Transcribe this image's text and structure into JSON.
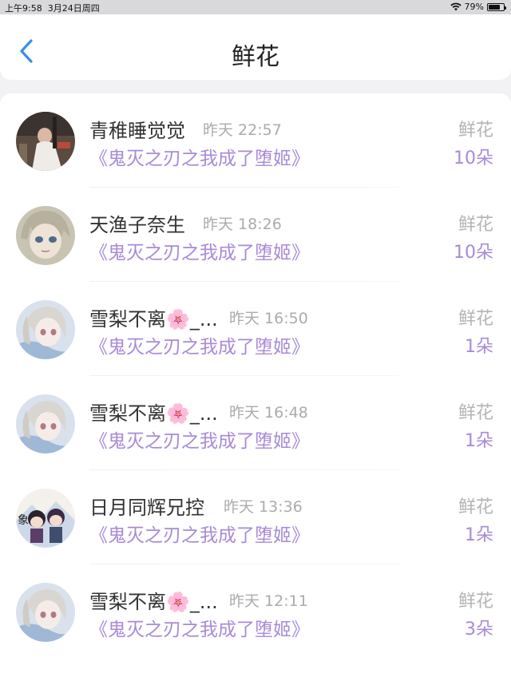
{
  "status_bar": {
    "time": "上午9:58",
    "date": "3月24日周四",
    "battery": "79%",
    "battery_level": 0.79
  },
  "nav": {
    "back_icon": "chevron-left-icon",
    "title": "鲜花",
    "accent": "#3a8ee6"
  },
  "list": {
    "items": [
      {
        "avatar": "portrait-photo",
        "name": "青稚睡觉觉",
        "time": "昨天 22:57",
        "book": "《鬼灭之刃之我成了堕姬》",
        "gift": "鲜花",
        "count": "10朵"
      },
      {
        "avatar": "anime-boy",
        "name": "天渔子奈生",
        "time": "昨天 18:26",
        "book": "《鬼灭之刃之我成了堕姬》",
        "gift": "鲜花",
        "count": "10朵"
      },
      {
        "avatar": "anime-girl",
        "name": "雪梨不离🌸_...",
        "time": "昨天 16:50",
        "book": "《鬼灭之刃之我成了堕姬》",
        "gift": "鲜花",
        "count": "1朵"
      },
      {
        "avatar": "anime-girl",
        "name": "雪梨不离🌸_...",
        "time": "昨天 16:48",
        "book": "《鬼灭之刃之我成了堕姬》",
        "gift": "鲜花",
        "count": "1朵"
      },
      {
        "avatar": "chibi-duo",
        "name": "日月同辉兄控",
        "time": "昨天 13:36",
        "book": "《鬼灭之刃之我成了堕姬》",
        "gift": "鲜花",
        "count": "1朵"
      },
      {
        "avatar": "anime-girl",
        "name": "雪梨不离🌸_...",
        "time": "昨天 12:11",
        "book": "《鬼灭之刃之我成了堕姬》",
        "gift": "鲜花",
        "count": "3朵"
      }
    ]
  },
  "colors": {
    "book_purple": "#a88ad8",
    "muted_gray": "#ababab"
  }
}
